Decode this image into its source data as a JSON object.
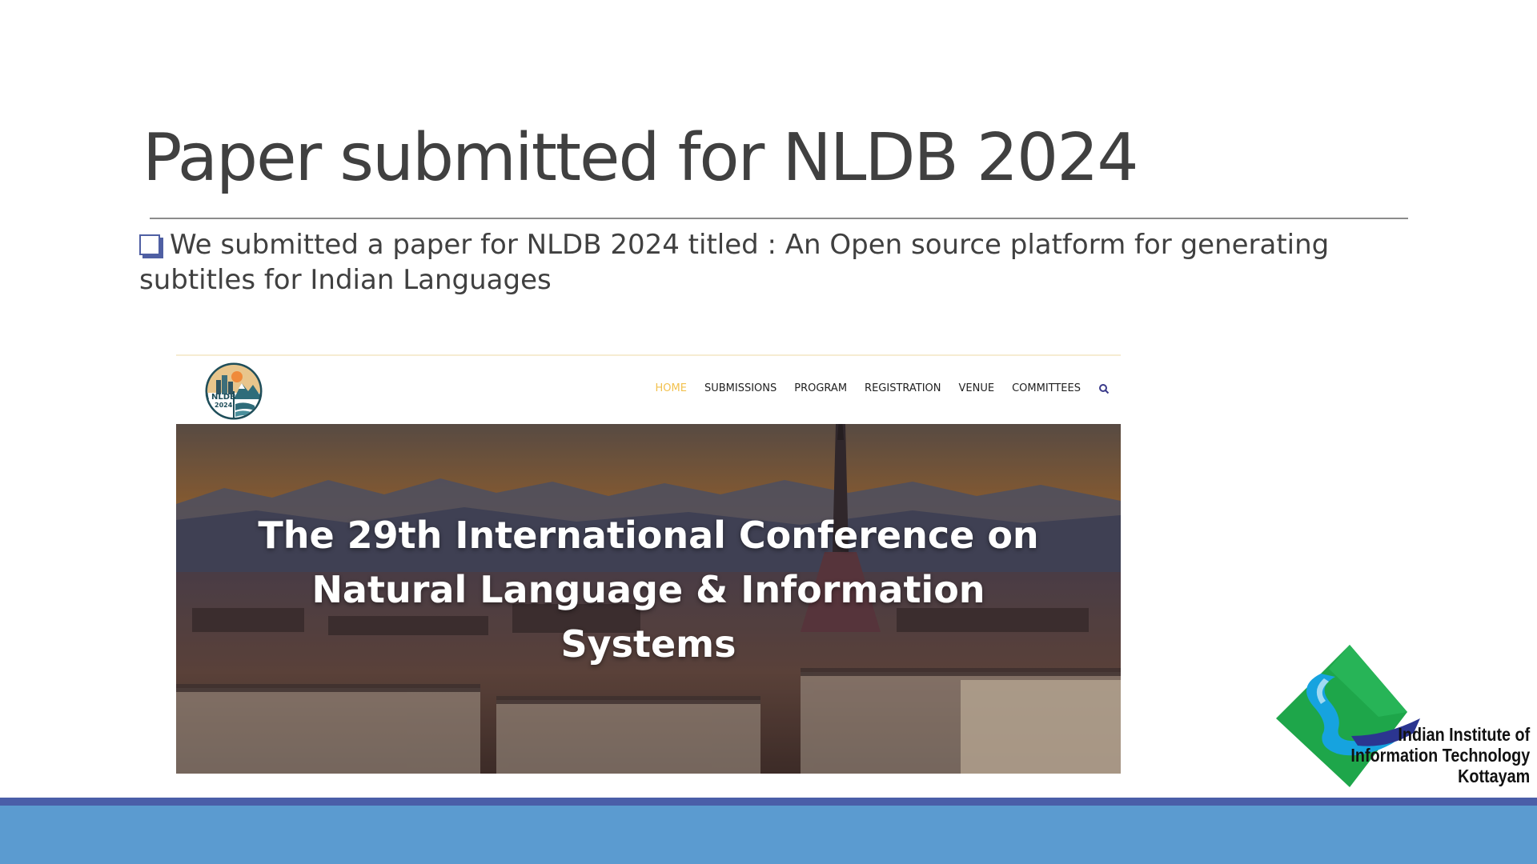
{
  "slide": {
    "title": "Paper submitted for NLDB 2024",
    "bullet_text": "We submitted a paper for NLDB 2024 titled : An Open source platform for generating subtitles for Indian Languages"
  },
  "website": {
    "logo_text": "NLDB",
    "logo_year": "2024",
    "nav": {
      "items": [
        "HOME",
        "SUBMISSIONS",
        "PROGRAM",
        "REGISTRATION",
        "VENUE",
        "COMMITTEES"
      ],
      "active_item": "HOME",
      "active_color": "#f2c14e",
      "search_icon": "search-icon"
    },
    "hero_lines": [
      "The 29th International Conference on",
      "Natural Language & Information",
      "Systems"
    ]
  },
  "institute_logo": {
    "lines": [
      "Indian Institute of",
      "Information Technology",
      "Kottayam"
    ],
    "colors": {
      "green": "#1ea64a",
      "blue": "#16a3df",
      "navy": "#2b3590"
    }
  },
  "theme": {
    "title_color": "#404040",
    "bullet_color": "#4f5fa3",
    "footer_stripe": "#4a5ea8",
    "footer_band": "#5b9bd0"
  }
}
